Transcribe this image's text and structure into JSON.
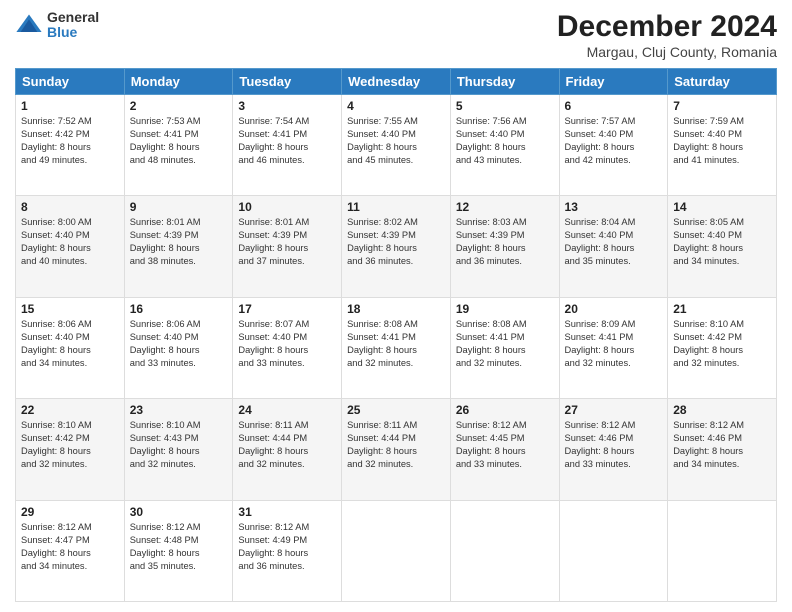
{
  "logo": {
    "general": "General",
    "blue": "Blue"
  },
  "header": {
    "month": "December 2024",
    "location": "Margau, Cluj County, Romania"
  },
  "weekdays": [
    "Sunday",
    "Monday",
    "Tuesday",
    "Wednesday",
    "Thursday",
    "Friday",
    "Saturday"
  ],
  "weeks": [
    [
      {
        "day": "1",
        "text": "Sunrise: 7:52 AM\nSunset: 4:42 PM\nDaylight: 8 hours\nand 49 minutes."
      },
      {
        "day": "2",
        "text": "Sunrise: 7:53 AM\nSunset: 4:41 PM\nDaylight: 8 hours\nand 48 minutes."
      },
      {
        "day": "3",
        "text": "Sunrise: 7:54 AM\nSunset: 4:41 PM\nDaylight: 8 hours\nand 46 minutes."
      },
      {
        "day": "4",
        "text": "Sunrise: 7:55 AM\nSunset: 4:40 PM\nDaylight: 8 hours\nand 45 minutes."
      },
      {
        "day": "5",
        "text": "Sunrise: 7:56 AM\nSunset: 4:40 PM\nDaylight: 8 hours\nand 43 minutes."
      },
      {
        "day": "6",
        "text": "Sunrise: 7:57 AM\nSunset: 4:40 PM\nDaylight: 8 hours\nand 42 minutes."
      },
      {
        "day": "7",
        "text": "Sunrise: 7:59 AM\nSunset: 4:40 PM\nDaylight: 8 hours\nand 41 minutes."
      }
    ],
    [
      {
        "day": "8",
        "text": "Sunrise: 8:00 AM\nSunset: 4:40 PM\nDaylight: 8 hours\nand 40 minutes."
      },
      {
        "day": "9",
        "text": "Sunrise: 8:01 AM\nSunset: 4:39 PM\nDaylight: 8 hours\nand 38 minutes."
      },
      {
        "day": "10",
        "text": "Sunrise: 8:01 AM\nSunset: 4:39 PM\nDaylight: 8 hours\nand 37 minutes."
      },
      {
        "day": "11",
        "text": "Sunrise: 8:02 AM\nSunset: 4:39 PM\nDaylight: 8 hours\nand 36 minutes."
      },
      {
        "day": "12",
        "text": "Sunrise: 8:03 AM\nSunset: 4:39 PM\nDaylight: 8 hours\nand 36 minutes."
      },
      {
        "day": "13",
        "text": "Sunrise: 8:04 AM\nSunset: 4:40 PM\nDaylight: 8 hours\nand 35 minutes."
      },
      {
        "day": "14",
        "text": "Sunrise: 8:05 AM\nSunset: 4:40 PM\nDaylight: 8 hours\nand 34 minutes."
      }
    ],
    [
      {
        "day": "15",
        "text": "Sunrise: 8:06 AM\nSunset: 4:40 PM\nDaylight: 8 hours\nand 34 minutes."
      },
      {
        "day": "16",
        "text": "Sunrise: 8:06 AM\nSunset: 4:40 PM\nDaylight: 8 hours\nand 33 minutes."
      },
      {
        "day": "17",
        "text": "Sunrise: 8:07 AM\nSunset: 4:40 PM\nDaylight: 8 hours\nand 33 minutes."
      },
      {
        "day": "18",
        "text": "Sunrise: 8:08 AM\nSunset: 4:41 PM\nDaylight: 8 hours\nand 32 minutes."
      },
      {
        "day": "19",
        "text": "Sunrise: 8:08 AM\nSunset: 4:41 PM\nDaylight: 8 hours\nand 32 minutes."
      },
      {
        "day": "20",
        "text": "Sunrise: 8:09 AM\nSunset: 4:41 PM\nDaylight: 8 hours\nand 32 minutes."
      },
      {
        "day": "21",
        "text": "Sunrise: 8:10 AM\nSunset: 4:42 PM\nDaylight: 8 hours\nand 32 minutes."
      }
    ],
    [
      {
        "day": "22",
        "text": "Sunrise: 8:10 AM\nSunset: 4:42 PM\nDaylight: 8 hours\nand 32 minutes."
      },
      {
        "day": "23",
        "text": "Sunrise: 8:10 AM\nSunset: 4:43 PM\nDaylight: 8 hours\nand 32 minutes."
      },
      {
        "day": "24",
        "text": "Sunrise: 8:11 AM\nSunset: 4:44 PM\nDaylight: 8 hours\nand 32 minutes."
      },
      {
        "day": "25",
        "text": "Sunrise: 8:11 AM\nSunset: 4:44 PM\nDaylight: 8 hours\nand 32 minutes."
      },
      {
        "day": "26",
        "text": "Sunrise: 8:12 AM\nSunset: 4:45 PM\nDaylight: 8 hours\nand 33 minutes."
      },
      {
        "day": "27",
        "text": "Sunrise: 8:12 AM\nSunset: 4:46 PM\nDaylight: 8 hours\nand 33 minutes."
      },
      {
        "day": "28",
        "text": "Sunrise: 8:12 AM\nSunset: 4:46 PM\nDaylight: 8 hours\nand 34 minutes."
      }
    ],
    [
      {
        "day": "29",
        "text": "Sunrise: 8:12 AM\nSunset: 4:47 PM\nDaylight: 8 hours\nand 34 minutes."
      },
      {
        "day": "30",
        "text": "Sunrise: 8:12 AM\nSunset: 4:48 PM\nDaylight: 8 hours\nand 35 minutes."
      },
      {
        "day": "31",
        "text": "Sunrise: 8:12 AM\nSunset: 4:49 PM\nDaylight: 8 hours\nand 36 minutes."
      },
      {
        "day": "",
        "text": ""
      },
      {
        "day": "",
        "text": ""
      },
      {
        "day": "",
        "text": ""
      },
      {
        "day": "",
        "text": ""
      }
    ]
  ]
}
